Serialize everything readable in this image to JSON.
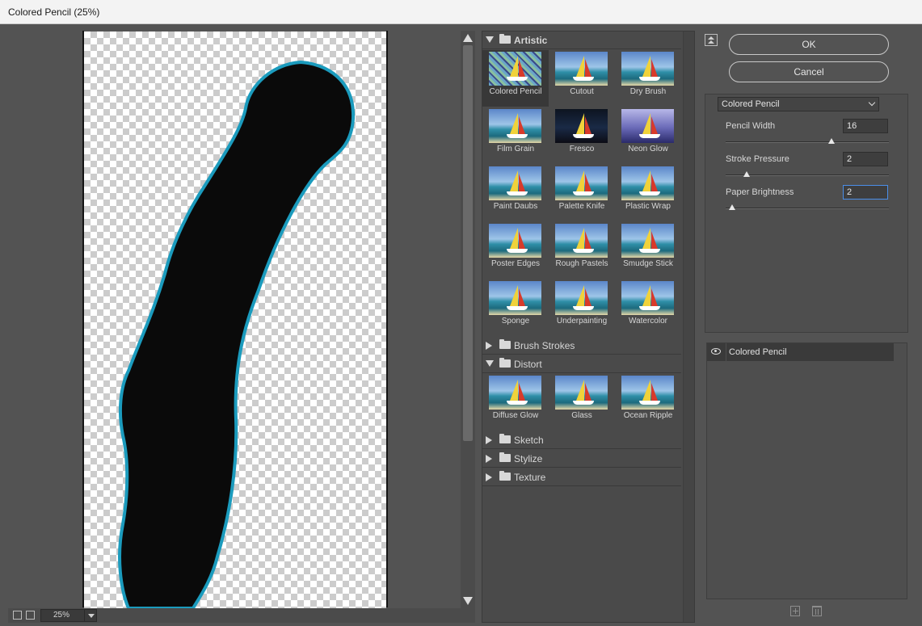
{
  "window": {
    "title": "Colored Pencil (25%)"
  },
  "preview": {
    "zoom": "25%"
  },
  "gallery": {
    "categories": [
      {
        "name": "Artistic",
        "expanded": true,
        "filters": [
          "Colored Pencil",
          "Cutout",
          "Dry Brush",
          "Film Grain",
          "Fresco",
          "Neon Glow",
          "Paint Daubs",
          "Palette Knife",
          "Plastic Wrap",
          "Poster Edges",
          "Rough Pastels",
          "Smudge Stick",
          "Sponge",
          "Underpainting",
          "Watercolor"
        ]
      },
      {
        "name": "Brush Strokes",
        "expanded": false
      },
      {
        "name": "Distort",
        "expanded": true,
        "filters": [
          "Diffuse Glow",
          "Glass",
          "Ocean Ripple"
        ]
      },
      {
        "name": "Sketch",
        "expanded": false
      },
      {
        "name": "Stylize",
        "expanded": false
      },
      {
        "name": "Texture",
        "expanded": false
      }
    ],
    "selected": "Colored Pencil"
  },
  "buttons": {
    "ok": "OK",
    "cancel": "Cancel"
  },
  "settings": {
    "filter_select": "Colored Pencil",
    "params": [
      {
        "label": "Pencil Width",
        "value": "16",
        "level": 0.65
      },
      {
        "label": "Stroke Pressure",
        "value": "2",
        "level": 0.13
      },
      {
        "label": "Paper Brightness",
        "value": "2",
        "level": 0.04
      }
    ]
  },
  "layers": {
    "items": [
      "Colored Pencil"
    ]
  },
  "colors": {
    "shape_fill": "#0a0a0a",
    "shape_stroke": "#1b9bbd",
    "focus": "#4a8ee8"
  }
}
